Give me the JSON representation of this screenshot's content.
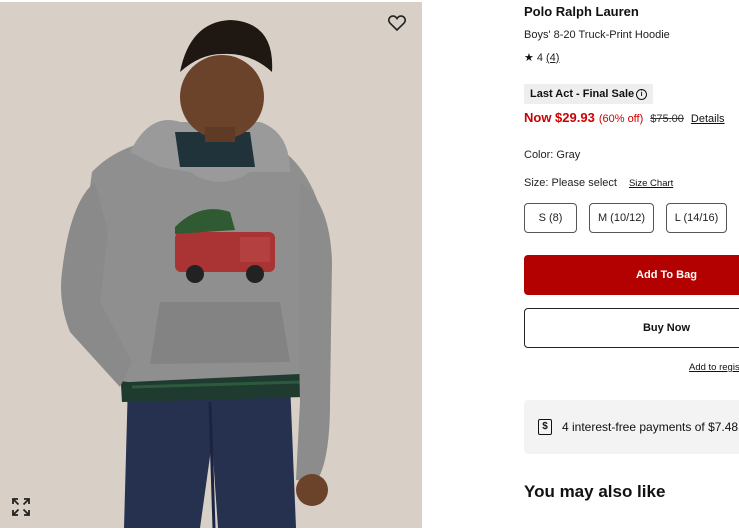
{
  "product": {
    "brand": "Polo Ralph Lauren",
    "name": "Boys' 8-20 Truck-Print Hoodie",
    "rating": "4",
    "review_count": "(4)",
    "badge": "Last Act - Final Sale",
    "price_now": "Now $29.93",
    "price_off": "(60% off)",
    "price_was": "$75.00",
    "price_details": "Details",
    "color": "Color: Gray",
    "size_prompt": "Size: Please select",
    "size_chart": "Size Chart"
  },
  "sizes": [
    {
      "label": "S (8)"
    },
    {
      "label": "M (10/12)"
    },
    {
      "label": "L (14/16)"
    }
  ],
  "actions": {
    "add_to_bag": "Add To Bag",
    "buy_now": "Buy Now",
    "add_to_registry": "Add to registry"
  },
  "payments": {
    "text": "4 interest-free payments of $7.48"
  },
  "recommendations": {
    "heading": "You may also like"
  },
  "icons": {
    "favorite": "heart-icon",
    "expand": "expand-icon",
    "star": "star-icon",
    "info": "info-icon",
    "payment": "dollar-icon"
  },
  "colors": {
    "sale_red": "#cc0000",
    "button_red": "#b30000",
    "badge_bg": "#eeeeee",
    "payments_bg": "#f3f3f3"
  }
}
